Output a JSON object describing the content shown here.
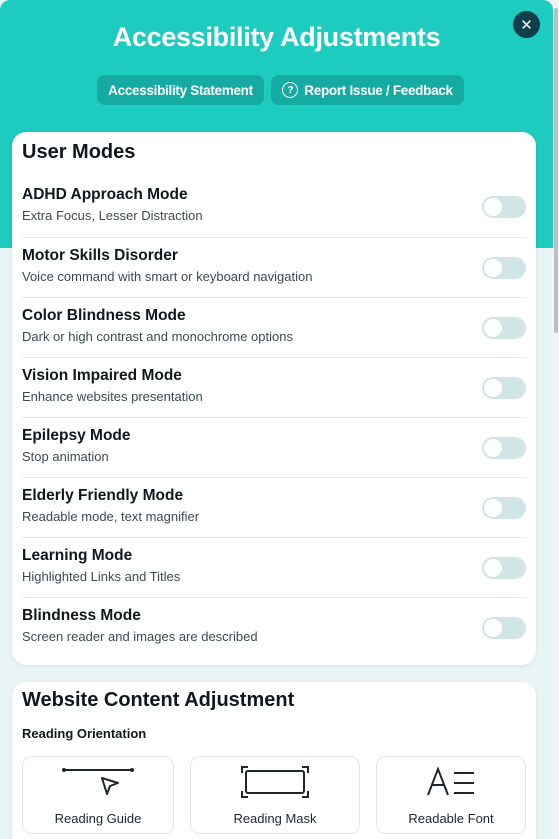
{
  "header": {
    "title": "Accessibility Adjustments",
    "statement_label": "Accessibility Statement",
    "report_label": "Report Issue / Feedback",
    "close_glyph": "✕"
  },
  "user_modes": {
    "heading": "User Modes",
    "items": [
      {
        "name": "ADHD Approach Mode",
        "desc": "Extra Focus, Lesser Distraction",
        "enabled": false
      },
      {
        "name": "Motor Skills Disorder",
        "desc": "Voice command with smart or keyboard navigation",
        "enabled": false
      },
      {
        "name": "Color Blindness Mode",
        "desc": "Dark or high contrast and monochrome options",
        "enabled": false
      },
      {
        "name": "Vision Impaired Mode",
        "desc": "Enhance websites presentation",
        "enabled": false
      },
      {
        "name": "Epilepsy Mode",
        "desc": "Stop animation",
        "enabled": false
      },
      {
        "name": "Elderly Friendly Mode",
        "desc": "Readable mode, text magnifier",
        "enabled": false
      },
      {
        "name": "Learning Mode",
        "desc": "Highlighted Links and Titles",
        "enabled": false
      },
      {
        "name": "Blindness Mode",
        "desc": "Screen reader and images are described",
        "enabled": false
      }
    ]
  },
  "content_adjustment": {
    "heading": "Website Content Adjustment",
    "subheading": "Reading Orientation",
    "tiles": [
      {
        "label": "Reading Guide",
        "icon": "reading-guide-icon"
      },
      {
        "label": "Reading Mask",
        "icon": "reading-mask-icon"
      },
      {
        "label": "Readable Font",
        "icon": "readable-font-icon"
      }
    ]
  },
  "colors": {
    "accent": "#1ecbbf",
    "pill": "#15aba2",
    "close_button": "#0e3f4a",
    "toggle_off": "#cfe5e6"
  }
}
